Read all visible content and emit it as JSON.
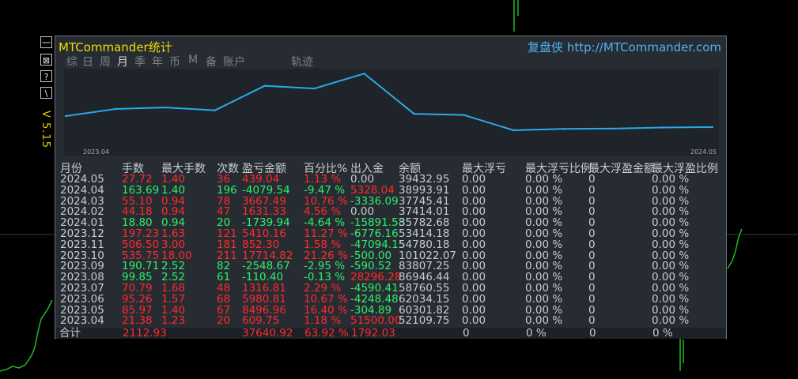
{
  "version": "V 5.15",
  "side_buttons": [
    "一",
    "⊠",
    "?",
    "\\"
  ],
  "title": "MTCommander统计",
  "site": "复盘侠 http://MTCommander.com",
  "tabs": [
    {
      "label": "综",
      "active": false
    },
    {
      "label": "日",
      "active": false
    },
    {
      "label": "周",
      "active": false
    },
    {
      "label": "月",
      "active": true
    },
    {
      "label": "季",
      "active": false
    },
    {
      "label": "年",
      "active": false
    },
    {
      "label": "币",
      "active": false
    },
    {
      "label": "M",
      "active": false
    },
    {
      "label": "备",
      "active": false
    },
    {
      "label": "账户",
      "active": false
    },
    {
      "label": "轨迹",
      "active": false
    }
  ],
  "chart_data": {
    "type": "line",
    "x_start_label": "2023.04",
    "x_end_label": "2024.05",
    "x": [
      "2023.04",
      "2023.05",
      "2023.06",
      "2023.07",
      "2023.08",
      "2023.09",
      "2023.10",
      "2023.11",
      "2023.12",
      "2024.01",
      "2024.02",
      "2024.03",
      "2024.04",
      "2024.05"
    ],
    "values": [
      52109.75,
      60301.82,
      62034.15,
      58760.55,
      86946.44,
      83807.25,
      101022.07,
      54780.18,
      53414.18,
      35782.68,
      37414.01,
      37745.41,
      38993.91,
      39432.95
    ],
    "color": "#2aa9e8"
  },
  "headers": [
    "月份",
    "手数",
    "最大手数",
    "次数",
    "盈亏金额",
    "百分比%",
    "出入金",
    "余额",
    "最大浮亏",
    "最大浮亏比例",
    "最大浮盈金额",
    "最大浮盈比例"
  ],
  "rows": [
    {
      "color": "red",
      "cells": [
        "2024.05",
        "27.72",
        "1.40",
        "36",
        "439.04",
        "1.13 %",
        "0.00",
        "39432.95",
        "0.00",
        "0.00 %",
        "0",
        "0.00 %"
      ]
    },
    {
      "color": "green",
      "cells": [
        "2024.04",
        "163.69",
        "1.40",
        "196",
        "-4079.54",
        "-9.47 %",
        "5328.04",
        "38993.91",
        "0.00",
        "0.00 %",
        "0",
        "0.00 %"
      ]
    },
    {
      "color": "red",
      "cells": [
        "2024.03",
        "55.10",
        "0.94",
        "78",
        "3667.49",
        "10.76 %",
        "-3336.09",
        "37745.41",
        "0.00",
        "0.00 %",
        "0",
        "0.00 %"
      ]
    },
    {
      "color": "red",
      "cells": [
        "2024.02",
        "44.18",
        "0.94",
        "47",
        "1631.33",
        "4.56 %",
        "0.00",
        "37414.01",
        "0.00",
        "0.00 %",
        "0",
        "0.00 %"
      ]
    },
    {
      "color": "green",
      "cells": [
        "2024.01",
        "18.80",
        "0.94",
        "20",
        "-1739.94",
        "-4.64 %",
        "-15891.58",
        "35782.68",
        "0.00",
        "0.00 %",
        "0",
        "0.00 %"
      ]
    },
    {
      "color": "red",
      "cells": [
        "2023.12",
        "197.23",
        "1.63",
        "121",
        "5410.16",
        "11.27 %",
        "-6776.16",
        "53414.18",
        "0.00",
        "0.00 %",
        "0",
        "0.00 %"
      ]
    },
    {
      "color": "red",
      "cells": [
        "2023.11",
        "506.50",
        "3.00",
        "181",
        "852.30",
        "1.58 %",
        "-47094.15",
        "54780.18",
        "0.00",
        "0.00 %",
        "0",
        "0.00 %"
      ]
    },
    {
      "color": "red",
      "cells": [
        "2023.10",
        "535.75",
        "18.00",
        "211",
        "17714.82",
        "21.26 %",
        "-500.00",
        "101022.07",
        "0.00",
        "0.00 %",
        "0",
        "0.00 %"
      ]
    },
    {
      "color": "green",
      "cells": [
        "2023.09",
        "190.71",
        "2.52",
        "82",
        "-2548.67",
        "-2.95 %",
        "-590.52",
        "83807.25",
        "0.00",
        "0.00 %",
        "0",
        "0.00 %"
      ]
    },
    {
      "color": "green",
      "cells": [
        "2023.08",
        "99.85",
        "2.52",
        "61",
        "-110.40",
        "-0.13 %",
        "28296.28",
        "86946.44",
        "0.00",
        "0.00 %",
        "0",
        "0.00 %"
      ]
    },
    {
      "color": "red",
      "cells": [
        "2023.07",
        "70.79",
        "1.68",
        "48",
        "1316.81",
        "2.29 %",
        "-4590.41",
        "58760.55",
        "0.00",
        "0.00 %",
        "0",
        "0.00 %"
      ]
    },
    {
      "color": "red",
      "cells": [
        "2023.06",
        "95.26",
        "1.57",
        "68",
        "5980.81",
        "10.67 %",
        "-4248.48",
        "62034.15",
        "0.00",
        "0.00 %",
        "0",
        "0.00 %"
      ]
    },
    {
      "color": "red",
      "cells": [
        "2023.05",
        "85.97",
        "1.40",
        "67",
        "8496.96",
        "16.40 %",
        "-304.89",
        "60301.82",
        "0.00",
        "0.00 %",
        "0",
        "0.00 %"
      ]
    },
    {
      "color": "red",
      "cells": [
        "2023.04",
        "21.38",
        "1.23",
        "20",
        "609.75",
        "1.18 %",
        "51500.00",
        "52109.75",
        "0.00",
        "0.00 %",
        "0",
        "0.00 %"
      ]
    }
  ],
  "totals": [
    "合计",
    "2112.93",
    "",
    "",
    "37640.92",
    "63.92 %",
    "1792.03",
    "",
    "0",
    "0 %",
    "0",
    "0 %"
  ],
  "colors": {
    "profit": "#ff2a2a",
    "loss": "#2cf06a",
    "neutral": "#c8ccd2",
    "accent": "#f0dc00",
    "link": "#4fb3f2",
    "price_line": "#22c52c"
  }
}
